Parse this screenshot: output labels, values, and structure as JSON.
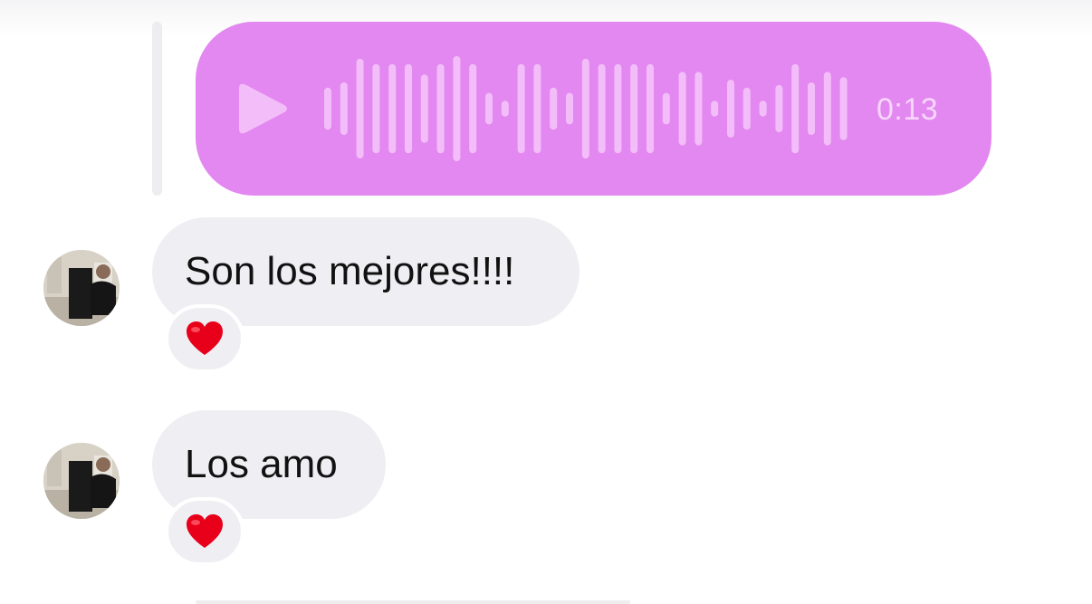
{
  "conversation": {
    "voice_message": {
      "duration": "0:13",
      "play_icon": "play-icon",
      "bubble_color": "#e388f0",
      "accent_color": "#f3bdf9",
      "waveform_levels": [
        0.4,
        0.5,
        0.95,
        0.85,
        0.85,
        0.85,
        0.65,
        0.85,
        1.0,
        0.85,
        0.3,
        0.15,
        0.85,
        0.85,
        0.4,
        0.3,
        0.95,
        0.85,
        0.85,
        0.85,
        0.85,
        0.3,
        0.7,
        0.7,
        0.15,
        0.55,
        0.4,
        0.15,
        0.45,
        0.85,
        0.5,
        0.7,
        0.6,
        0.05
      ]
    },
    "messages": [
      {
        "text": "Son los mejores!!!!",
        "reaction": "❤️",
        "avatar": "avatar"
      },
      {
        "text": "Los amo",
        "reaction": "❤️",
        "avatar": "avatar"
      }
    ]
  }
}
